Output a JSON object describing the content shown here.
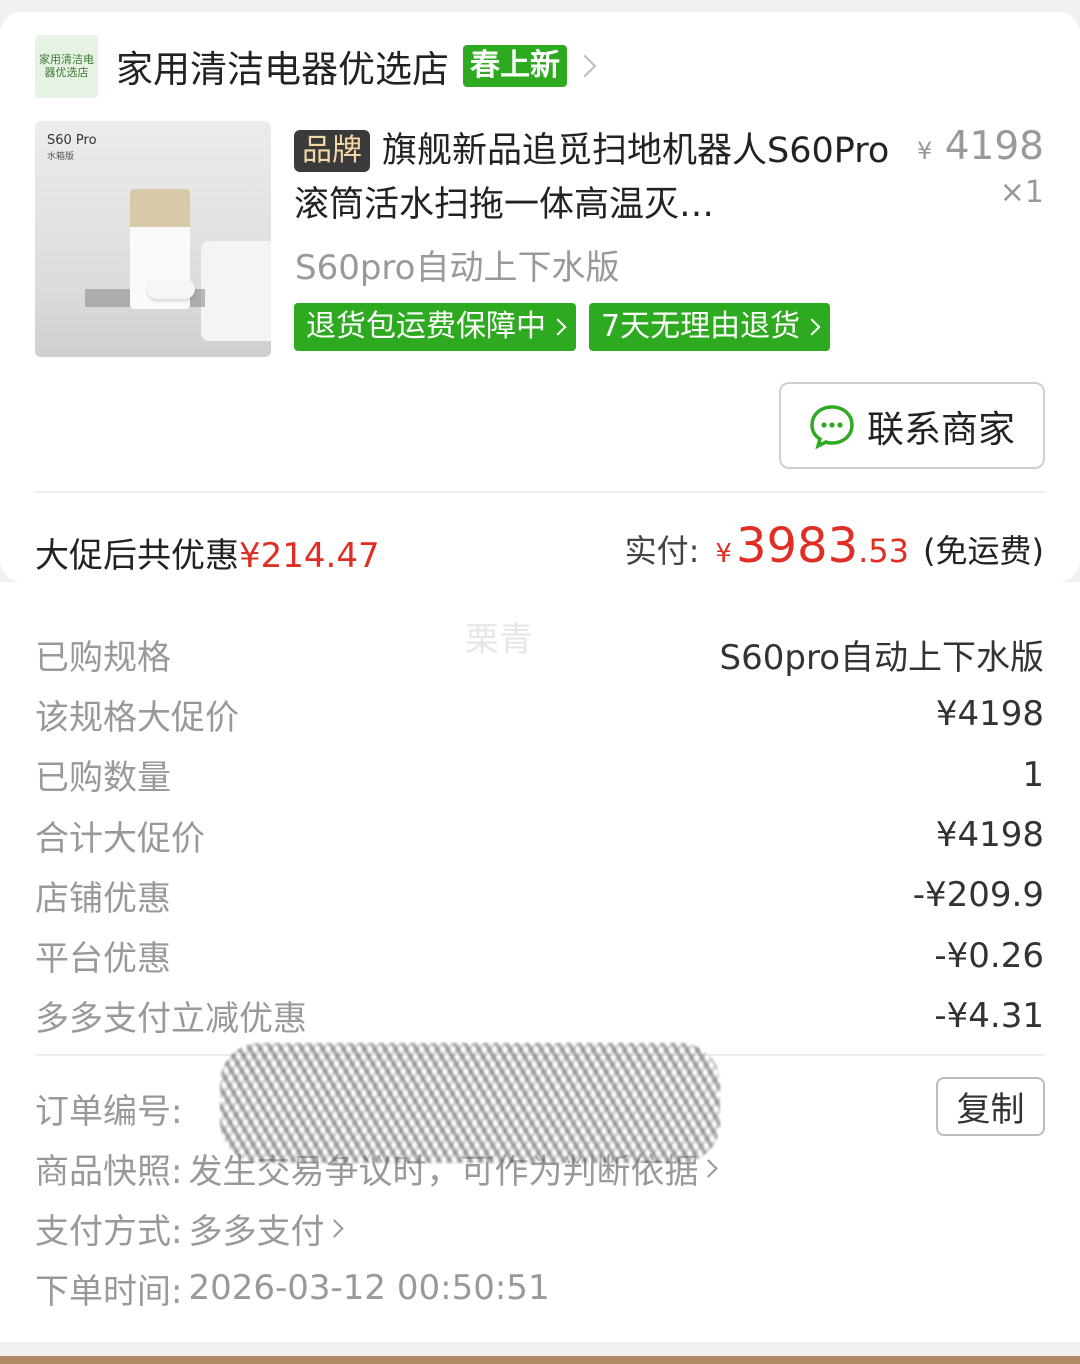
{
  "shop": {
    "logo_text": "家用清洁电器优选店",
    "name": "家用清洁电器优选店",
    "badge": "春上新"
  },
  "product": {
    "image_title": "S60 Pro",
    "image_subtitle": "水箱版",
    "brand_tag": "品牌",
    "title": "旗舰新品追觅扫地机器人S60Pro滚筒活水扫拖一体高温灭…",
    "price_symbol": "¥",
    "price": "4198",
    "quantity": "×1",
    "variant": "S60pro自动上下水版",
    "tags": [
      {
        "label": "退货包运费保障中"
      },
      {
        "label": "7天无理由退货"
      }
    ]
  },
  "contact": {
    "label": "联系商家",
    "icon": "chat-icon"
  },
  "summary": {
    "discount_label": "大促后共优惠",
    "discount_value": "¥214.47",
    "paid_label": "实付:",
    "paid_symbol": "¥",
    "paid_int": "3983",
    "paid_dec": ".53",
    "shipping": "(免运费)"
  },
  "watermark": "栗青",
  "details": [
    {
      "k": "已购规格",
      "v": "S60pro自动上下水版"
    },
    {
      "k": "该规格大促价",
      "v": "¥4198"
    },
    {
      "k": "已购数量",
      "v": "1"
    },
    {
      "k": "合计大促价",
      "v": "¥4198"
    },
    {
      "k": "店铺优惠",
      "v": "-¥209.9"
    },
    {
      "k": "平台优惠",
      "v": "-¥0.26"
    },
    {
      "k": "多多支付立减优惠",
      "v": "-¥4.31"
    }
  ],
  "order_info": {
    "order_no_label": "订单编号:",
    "copy_label": "复制",
    "snapshot_label": "商品快照:",
    "snapshot_value": "发生交易争议时，可作为判断依据",
    "pay_method_label": "支付方式:",
    "pay_method_value": "多多支付",
    "order_time_label": "下单时间:",
    "order_time_value": "2026-03-12 00:50:51"
  },
  "colors": {
    "accent_green": "#2eaa20",
    "price_red": "#e02e24",
    "muted_gray": "#999999"
  }
}
